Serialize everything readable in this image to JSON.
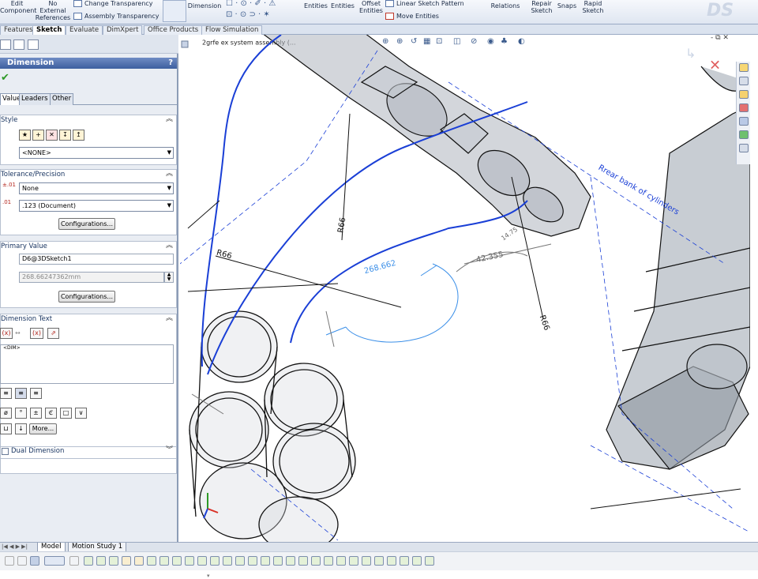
{
  "ribbon": {
    "edit_component": "Edit\nComponent",
    "no_external_references": "No\nExternal\nReferences",
    "change_transparency": "Change Transparency",
    "assembly_transparency": "Assembly Transparency",
    "dimension": "Dimension",
    "entities": "Entities",
    "entities2": "Entities",
    "offset_entities": "Offset\nEntities",
    "linear_sketch_pattern": "Linear Sketch Pattern",
    "move_entities": "Move Entities",
    "relations": "Relations",
    "repair_sketch": "Repair\nSketch",
    "snaps": "Snaps",
    "rapid_sketch": "Rapid\nSketch"
  },
  "command_tabs": [
    "Features",
    "Sketch",
    "Evaluate",
    "DimXpert",
    "Office Products",
    "Flow Simulation"
  ],
  "active_command_tab": "Sketch",
  "property_manager": {
    "title": "Dimension",
    "help": "?",
    "tabs": [
      "Value",
      "Leaders",
      "Other"
    ],
    "style": {
      "label": "Style",
      "dropdown": "<NONE>"
    },
    "tolerance": {
      "label": "Tolerance/Precision",
      "type": "None",
      "precision": ".123 (Document)",
      "config_button": "Configurations..."
    },
    "primary_value": {
      "label": "Primary Value",
      "name": "D6@3DSketch1",
      "value": "268.66247362mm",
      "config_button": "Configurations..."
    },
    "dimension_text": {
      "label": "Dimension Text",
      "content": "<DIM>",
      "more_button": "More..."
    },
    "dual_dimension": "Dual Dimension"
  },
  "viewport": {
    "tree_item": "2grfe ex system assembly (...",
    "annotations": {
      "r66_left": "R66",
      "r66_mid": "R66",
      "r66_right": "R66",
      "dim_268": "268.662",
      "dim_42": "42.355",
      "dim_14": "14.75",
      "rear_bank": "Rrear bank of cylinders"
    },
    "colors": {
      "sketch_blue": "#1a3fd6",
      "dim_blue": "#3b8fe8",
      "model_gray": "#9aa2ad"
    }
  },
  "bottom_tabs": [
    "Model",
    "Motion Study 1"
  ],
  "active_bottom_tab": "Model"
}
